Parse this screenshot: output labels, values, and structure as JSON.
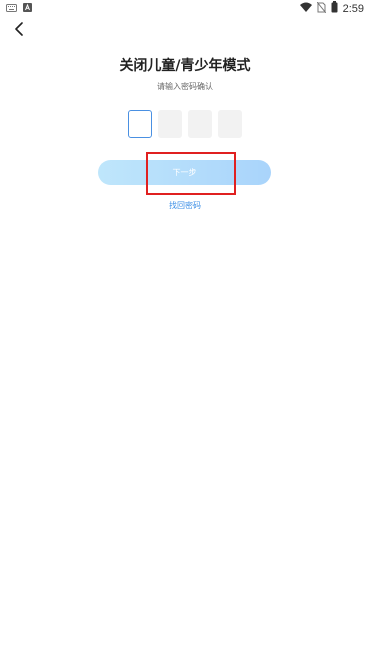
{
  "status_bar": {
    "time": "2:59",
    "left_icons": [
      "keyboard-icon",
      "notification-a-icon"
    ],
    "right_icons": [
      "wifi-icon",
      "no-sim-icon",
      "battery-icon"
    ]
  },
  "header": {
    "back_icon": "chevron-left-icon"
  },
  "main": {
    "title": "关闭儿童/青少年模式",
    "subtitle": "请输入密码确认",
    "pin_length": 4,
    "pin_active_index": 0,
    "next_label": "下一步",
    "find_password_label": "找回密码"
  },
  "colors": {
    "accent": "#3a8ee6",
    "button_start": "#bfe6fb",
    "button_end": "#a9d4fb",
    "highlight": "#e02020"
  }
}
